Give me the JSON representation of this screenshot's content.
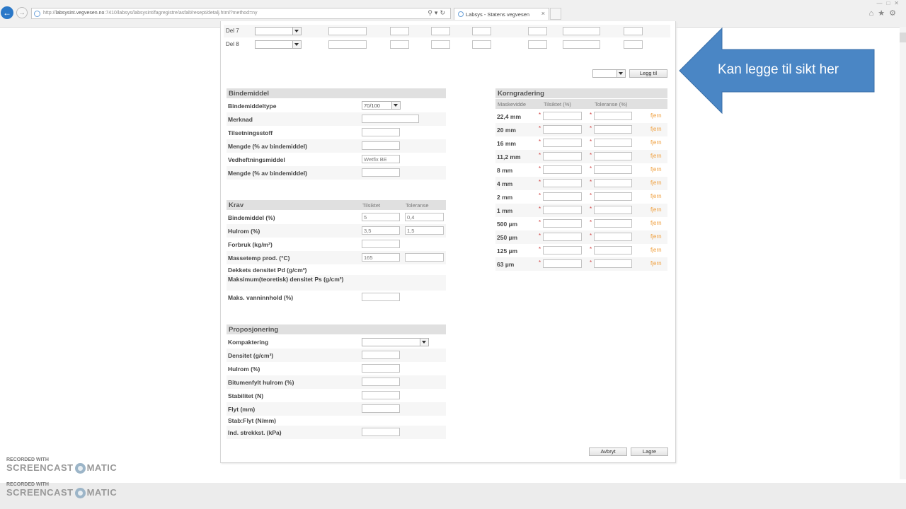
{
  "browser": {
    "url_prefix": "http://",
    "url_host": "labsysint.vegvesen.no",
    "url_path": ":7410/labsys/labsysint/fagregistre/asfalt/resept/detalj.html?method=ny",
    "tab_title": "Labsys - Statens vegvesen",
    "tab_close": "×"
  },
  "del_rows": [
    {
      "label": "Del 7"
    },
    {
      "label": "Del 8"
    }
  ],
  "sikt": {
    "add_label": "Legg til"
  },
  "bindemiddel": {
    "title": "Bindemiddel",
    "rows": [
      {
        "label": "Bindemiddeltype",
        "value": "70/100"
      },
      {
        "label": "Merknad",
        "value": ""
      },
      {
        "label": "Tilsetningsstoff",
        "value": ""
      },
      {
        "label": "Mengde (% av bindemiddel)",
        "value": ""
      },
      {
        "label": "Vedheftningsmiddel",
        "value": "Wetfix BE"
      },
      {
        "label": "Mengde (% av bindemiddel)",
        "value": ""
      }
    ]
  },
  "krav": {
    "title": "Krav",
    "col_target": "Tilsiktet",
    "col_tol": "Toleranse",
    "rows": [
      {
        "label": "Bindemiddel (%)",
        "target": "5",
        "tol": "0,4"
      },
      {
        "label": "Hulrom (%)",
        "target": "3,5",
        "tol": "1,5"
      },
      {
        "label": "Forbruk (kg/m²)",
        "target": ""
      },
      {
        "label": "Massetemp prod. (°C)",
        "target": "165",
        "tol": ""
      },
      {
        "label": "Dekkets densitet Pd (g/cm³)"
      },
      {
        "label": "Maksimum(teoretisk) densitet Ps (g/cm³)"
      },
      {
        "label": "Maks. vanninnhold (%)",
        "target": ""
      }
    ]
  },
  "proposjonering": {
    "title": "Proposjonering",
    "rows": [
      {
        "label": "Kompaktering"
      },
      {
        "label": "Densitet (g/cm³)"
      },
      {
        "label": "Hulrom (%)"
      },
      {
        "label": "Bitumenfylt hulrom (%)"
      },
      {
        "label": "Stabilitet (N)"
      },
      {
        "label": "Flyt (mm)"
      },
      {
        "label": "Stab:Flyt (N/mm)"
      },
      {
        "label": "Ind. strekkst. (kPa)"
      }
    ]
  },
  "korngradering": {
    "title": "Korngradering",
    "col_mesh": "Maskevidde",
    "col_target": "Tilsiktet (%)",
    "col_tol": "Toleranse (%)",
    "required_mark": "*",
    "remove_label": "fjern",
    "sieves": [
      "22,4 mm",
      "20 mm",
      "16 mm",
      "11,2 mm",
      "8 mm",
      "4 mm",
      "2 mm",
      "1 mm",
      "500 µm",
      "250 µm",
      "125 µm",
      "63 µm"
    ]
  },
  "actions": {
    "cancel": "Avbryt",
    "save": "Lagre"
  },
  "annotation": {
    "text": "Kan legge til sikt her",
    "color": "#4a86c5"
  },
  "watermark": {
    "recorded_with": "RECORDED WITH",
    "brand_left": "SCREENCAST",
    "brand_right": "MATIC"
  }
}
